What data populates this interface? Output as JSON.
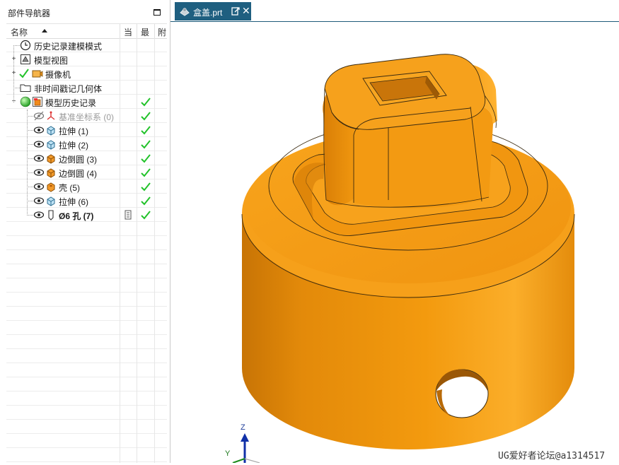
{
  "navigator": {
    "title": "部件导航器",
    "columns": {
      "name": "名称",
      "current": "当",
      "latest": "最",
      "attach": "附"
    },
    "rows": [
      {
        "label": "历史记录建模模式",
        "icon": "clock-icon"
      },
      {
        "label": "模型视图",
        "icon": "model-view-icon"
      },
      {
        "label": "摄像机",
        "icon": "camera-icon"
      },
      {
        "label": "非时间戳记几何体",
        "icon": "folder-icon"
      },
      {
        "label": "模型历史记录",
        "icon": "model-history-icon"
      },
      {
        "label": "基准坐标系 (0)",
        "icon": "datum-csys-icon"
      },
      {
        "label": "拉伸 (1)",
        "icon": "extrude-icon"
      },
      {
        "label": "拉伸 (2)",
        "icon": "extrude-icon"
      },
      {
        "label": "边倒圆 (3)",
        "icon": "edge-blend-icon"
      },
      {
        "label": "边倒圆 (4)",
        "icon": "edge-blend-icon"
      },
      {
        "label": "壳 (5)",
        "icon": "shell-icon"
      },
      {
        "label": "拉伸 (6)",
        "icon": "extrude-icon"
      },
      {
        "label": "Ø6 孔 (7)",
        "icon": "hole-icon"
      }
    ]
  },
  "tab": {
    "label": "盒盖.prt"
  },
  "viewport": {
    "axis_z": "Z",
    "axis_y": "Y",
    "watermark": "UG爱好者论坛@a1314517"
  },
  "colors": {
    "part_orange": "#f39a0e",
    "tab_blue": "#1f5f80",
    "check_green": "#22c22a"
  }
}
